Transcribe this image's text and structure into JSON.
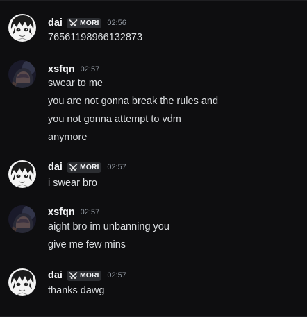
{
  "messages": [
    {
      "username": "dai",
      "tag": "MORI",
      "timestamp": "02:56",
      "lines": [
        "76561198966132873"
      ]
    },
    {
      "username": "xsfqn",
      "timestamp": "02:57",
      "lines": [
        "swear to me",
        "you are not gonna break the rules and",
        "you not gonna attempt to vdm",
        "anymore"
      ]
    },
    {
      "username": "dai",
      "tag": "MORI",
      "timestamp": "02:57",
      "lines": [
        "i swear bro"
      ]
    },
    {
      "username": "xsfqn",
      "timestamp": "02:57",
      "lines": [
        "aight bro im unbanning you",
        "give me few mins"
      ]
    },
    {
      "username": "dai",
      "tag": "MORI",
      "timestamp": "02:57",
      "lines": [
        "thanks dawg"
      ]
    }
  ],
  "icons": {
    "tag": "crossed-swords-icon",
    "avatar_dai": "anime-boy-avatar",
    "avatar_xsfqn": "hooded-figure-avatar"
  },
  "colors": {
    "background": "#0e0e10",
    "username": "#f2f3f5",
    "message_text": "#dbdee1",
    "timestamp": "#949ba4",
    "tag_background": "#2b2d31"
  }
}
